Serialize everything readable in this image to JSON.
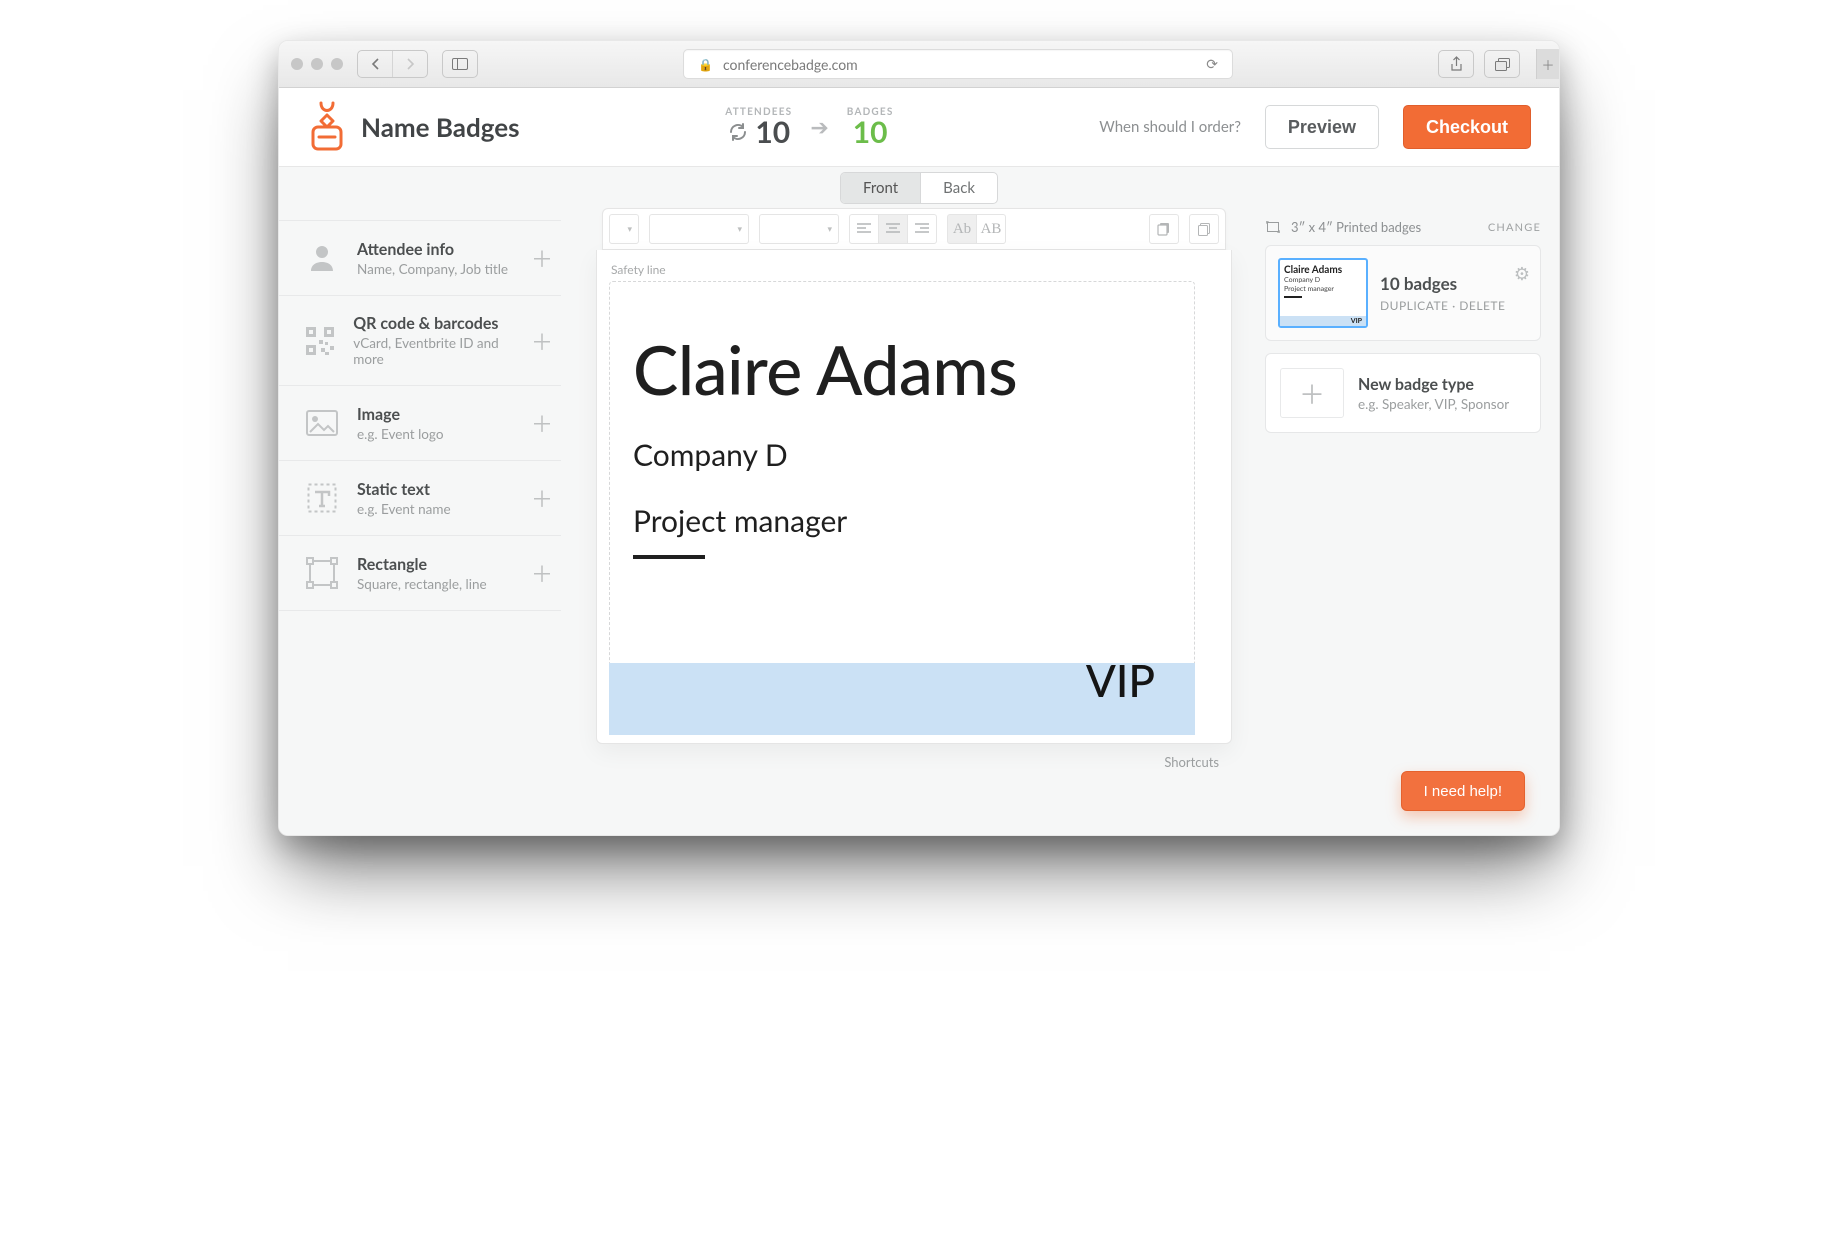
{
  "browser": {
    "url": "conferencebadge.com"
  },
  "header": {
    "title": "Name Badges",
    "attendees_label": "ATTENDEES",
    "badges_label": "BADGES",
    "attendees_count": "10",
    "badges_count": "10",
    "order_question": "When should I order?",
    "preview_label": "Preview",
    "checkout_label": "Checkout"
  },
  "side_tabs": {
    "front": "Front",
    "back": "Back",
    "active": "front"
  },
  "left_tools": [
    {
      "id": "attendee-info",
      "title": "Attendee info",
      "sub": "Name, Company, Job title",
      "icon": "person-icon"
    },
    {
      "id": "qr",
      "title": "QR code & barcodes",
      "sub": "vCard, Eventbrite ID and more",
      "icon": "qr-icon"
    },
    {
      "id": "image",
      "title": "Image",
      "sub": "e.g. Event logo",
      "icon": "image-icon"
    },
    {
      "id": "static-text",
      "title": "Static text",
      "sub": "e.g. Event name",
      "icon": "text-icon"
    },
    {
      "id": "rectangle",
      "title": "Rectangle",
      "sub": "Square, rectangle, line",
      "icon": "rect-icon"
    }
  ],
  "canvas": {
    "safety_label": "Safety line",
    "sample": {
      "name": "Claire Adams",
      "company": "Company D",
      "title": "Project manager",
      "footer": "VIP",
      "footer_bg": "#cbe1f5"
    },
    "shortcuts_label": "Shortcuts"
  },
  "right": {
    "size_text": "3″ x 4″  Printed badges",
    "change_label": "CHANGE",
    "badge_card": {
      "title": "10 badges",
      "duplicate": "DUPLICATE",
      "delete": "DELETE",
      "thumb": {
        "name": "Claire Adams",
        "company": "Company D",
        "role": "Project manager",
        "vip": "VIP"
      }
    },
    "new_type": {
      "title": "New badge type",
      "sub": "e.g. Speaker, VIP, Sponsor"
    }
  },
  "help_label": "I need help!",
  "colors": {
    "accent": "#f26c35",
    "success": "#6cbd4a"
  }
}
